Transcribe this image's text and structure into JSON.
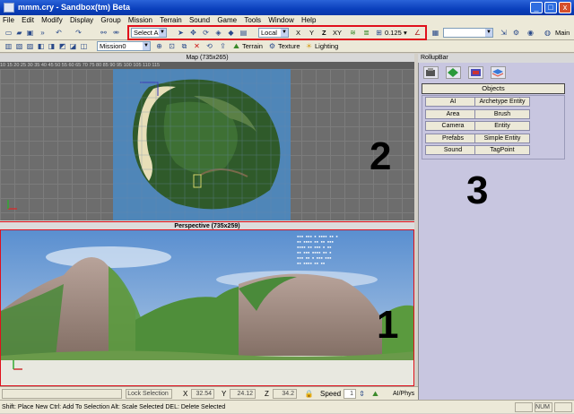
{
  "window": {
    "title": "mmm.cry - Sandbox(tm) Beta",
    "min": "_",
    "max": "□",
    "close": "x"
  },
  "menu": [
    "File",
    "Edit",
    "Modify",
    "Display",
    "Group",
    "Mission",
    "Terrain",
    "Sound",
    "Game",
    "Tools",
    "Window",
    "Help"
  ],
  "toolbar1": {
    "select_filter": "Select All",
    "coord_system": "Local",
    "axis_x": "X",
    "axis_y": "Y",
    "axis_z": "Z",
    "axis_xy": "XY",
    "grid_size": "0.125",
    "main_label": "Main"
  },
  "toolbar2": {
    "mission": "Mission0",
    "terrain_label": "Terrain",
    "texture_label": "Texture",
    "lighting_label": "Lighting"
  },
  "map_view": {
    "header": "Map (735x265)",
    "ruler": "10   15   20   25   30   35   40   45   50   55   60   65   70   75   80   85   90   95   100   105   110   115"
  },
  "perspective_view": {
    "header": "Perspective (735x259)"
  },
  "rollup": {
    "title": "RollupBar",
    "objects_label": "Objects",
    "buttons": [
      "AI",
      "Archetype Entity",
      "Area",
      "Brush",
      "Camera",
      "Entity",
      "Prefabs",
      "Simple Entity",
      "Sound",
      "TagPoint"
    ]
  },
  "annotations": {
    "one": "1",
    "two": "2",
    "three": "3"
  },
  "status_row": {
    "lock_selection": "Lock Selection",
    "x_label": "X",
    "x_value": "32.54",
    "y_label": "Y",
    "y_value": "24.12",
    "z_label": "Z",
    "z_value": "34.2",
    "speed_label": "Speed",
    "speed_value": "1",
    "ai_label": "AI/Phys"
  },
  "status_bar": {
    "hint": "Shift: Place New  Ctrl: Add To Selection  Alt: Scale Selected  DEL: Delete Selected",
    "num": "NUM"
  }
}
